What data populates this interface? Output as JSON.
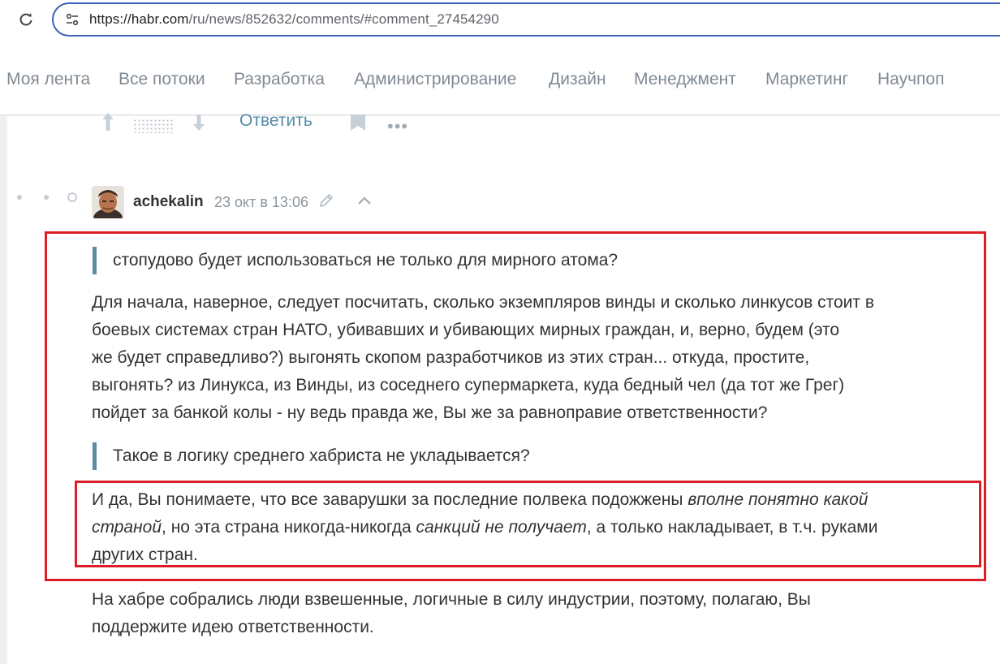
{
  "browser": {
    "url_host": "https://habr.com",
    "url_path": "/ru/news/852632/comments/#comment_27454290"
  },
  "nav": {
    "items": [
      "Моя лента",
      "Все потоки",
      "Разработка",
      "Администрирование",
      "Дизайн",
      "Менеджмент",
      "Маркетинг",
      "Научпоп"
    ]
  },
  "prev_comment": {
    "reply_label": "Ответить"
  },
  "comment": {
    "author": "achekalin",
    "timestamp": "23 окт в 13:06",
    "quote1": "стопудово будет использоваться не только для мирного атома?",
    "para1_lines": [
      "Для начала, наверное, следует посчитать, сколько экземпляров винды и сколько линкусов стоит в",
      "боевых системах стран НАТО, убивавших и убивающих мирных граждан, и, верно, будем (это",
      "же будет справедливо?) выгонять скопом разработчиков из этих стран... откуда, простите,",
      "выгонять? из Линукса, из Винды, из соседнего супермаркета, куда бедный чел (да тот же Грег)",
      "пойдет за банкой колы - ну ведь правда же, Вы же за равноправие ответственности?"
    ],
    "quote2": "Такое в логику среднего хабриста не укладывается?",
    "para2": {
      "l1_a": "И да, Вы понимаете, что все заварушки за последние полвека подожжены ",
      "l1_em": "вполне понятно какой",
      "l2_em1": "страной",
      "l2_b": ", но эта страна никогда-никогда ",
      "l2_em2": "санкций не получает",
      "l2_c": ", а только накладывает, в т.ч. руками",
      "l3": "других стран."
    },
    "para3_lines": [
      "На хабре собрались люди взвешенные, логичные в силу индустрии, поэтому, полагаю, Вы",
      "поддержите идею ответственности."
    ]
  },
  "colors": {
    "highlight_frame": "#dc1f26",
    "quote_bar": "#5e8aa2",
    "link": "#548eaa",
    "nav_text": "#818a93"
  }
}
